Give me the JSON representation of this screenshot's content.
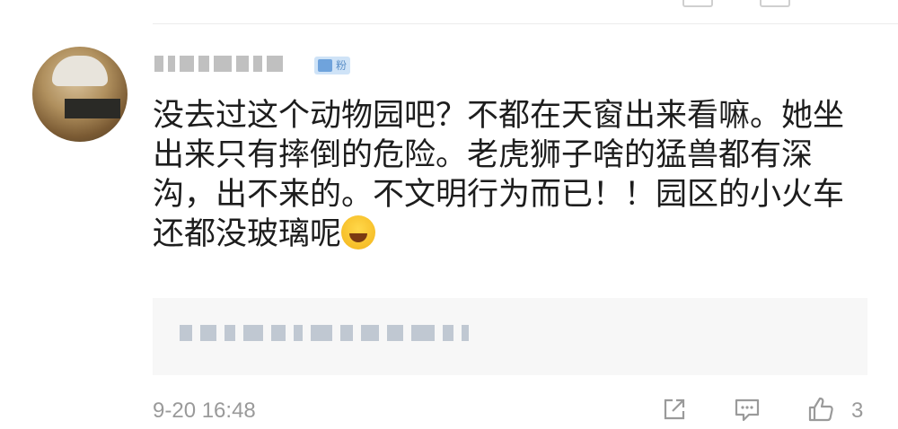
{
  "comment": {
    "username": "",
    "fan_badge": "粉",
    "text": "没去过这个动物园吧？不都在天窗出来看嘛。她坐出来只有摔倒的危险。老虎狮子啥的猛兽都有深沟，出不来的。不文明行为而已！！园区的小火车还都没玻璃呢",
    "emoji": "laughing-tears-emoji",
    "quoted_reply": "",
    "timestamp": "9-20 16:48",
    "like_count": "3"
  },
  "icons": {
    "share": "share-icon",
    "reply": "comment-icon",
    "like": "thumbs-up-icon"
  },
  "colors": {
    "text": "#1d1d1d",
    "meta": "#9a9a9a",
    "badge_bg": "#cfe3f7",
    "badge_fg": "#5a8fc8",
    "quote_bg": "#f7f7f7"
  }
}
